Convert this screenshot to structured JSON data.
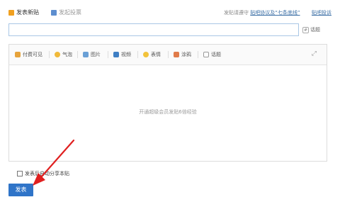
{
  "header": {
    "new_post_label": "发表新贴",
    "poll_label": "发起投票",
    "agreement_prefix": "发贴请遵守",
    "agreement_link": "贴吧协议及“七条底线”",
    "report_link": "贴吧投诉"
  },
  "title_input": {
    "value": "",
    "placeholder": ""
  },
  "topic_label": "话题",
  "toolbar": {
    "items": [
      {
        "label": "付费可见",
        "icon": "paid-icon",
        "color": "#e6a33b"
      },
      {
        "label": "气泡",
        "icon": "bubble-icon",
        "color": "#f0b93a"
      },
      {
        "label": "图片",
        "icon": "image-icon",
        "color": "#6aa0d6"
      },
      {
        "label": "视频",
        "icon": "video-icon",
        "color": "#3f7fc4"
      },
      {
        "label": "表情",
        "icon": "emoji-icon",
        "color": "#f2c33b"
      },
      {
        "label": "涂鸦",
        "icon": "doodle-icon",
        "color": "#e07b4a"
      },
      {
        "label": "话题",
        "icon": "topic-icon",
        "color": "#888888"
      }
    ],
    "expand_icon": "expand-icon"
  },
  "editor": {
    "placeholder": "开通超级会员发贴6倍经验"
  },
  "share": {
    "label": "发表后自动分享本贴",
    "checked": false
  },
  "submit_label": "发表",
  "colors": {
    "accent": "#2f74c8",
    "link": "#3a6ea5",
    "arrow": "#e02020"
  }
}
